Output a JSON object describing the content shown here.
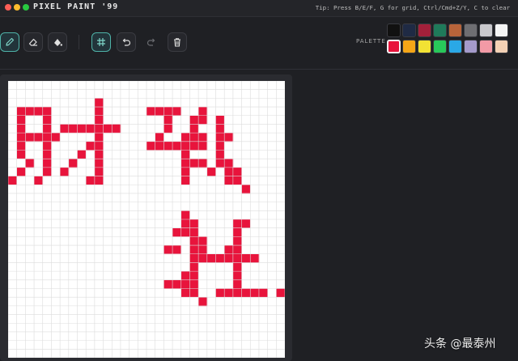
{
  "window": {
    "title": "PIXEL PAINT '99",
    "tip": "Tip: Press B/E/F, G for grid, Ctrl/Cmd+Z/Y, C to clear"
  },
  "toolbar": {
    "tools": [
      {
        "name": "pencil-tool",
        "icon": "pencil-icon",
        "active": true
      },
      {
        "name": "eraser-tool",
        "icon": "eraser-icon",
        "active": false
      },
      {
        "name": "fill-tool",
        "icon": "paint-bucket-icon",
        "active": false
      }
    ],
    "actions": [
      {
        "name": "grid-toggle",
        "icon": "grid-icon",
        "active": true
      },
      {
        "name": "undo",
        "icon": "undo-icon",
        "active": false
      },
      {
        "name": "redo",
        "icon": "redo-icon",
        "active": false
      },
      {
        "name": "clear",
        "icon": "trash-icon",
        "active": false
      }
    ]
  },
  "palette": {
    "label": "PALETTE",
    "colors": [
      "#111111",
      "#1f2a44",
      "#a3203a",
      "#1f7a5a",
      "#b8643a",
      "#6e6e72",
      "#c8c8cc",
      "#f4f4f4",
      "#e8143c",
      "#f5a617",
      "#f2e234",
      "#28c85a",
      "#2aa8e6",
      "#a49acb",
      "#f29aa6",
      "#f3d1b5"
    ],
    "selected": "#e8143c"
  },
  "canvas": {
    "cols": 32,
    "rows": 32,
    "background": "#ffffff",
    "grid_color": "#dcdcdc",
    "ink": "#e8143c",
    "rows_art": [
      "................................",
      "................................",
      "..........#.....................",
      ".####.....#.....####..#.........",
      ".#..#.....#.......#..##.#.......",
      ".#..#.#######.....#..#..#.......",
      ".#####....#......#..###.##......",
      ".#..#....##.....#######.#.......",
      ".#..#...#.#.........#...#.......",
      "..#.#..#..#.........###.##......",
      ".#..#.#...#.........#..#.##.....",
      "#..#.....##.........#....##.....",
      "...........................#....",
      "................................",
      "................................",
      "....................#...........",
      "....................##....##....",
      "...................###....#.....",
      ".....................##...#.....",
      "..................##.##..##.....",
      ".....................########...",
      ".....................#....#.....",
      "....................##....#.....",
      "..................####....#.....",
      "....................##..######.#",
      "......................#.........",
      "................................",
      "................................",
      "................................",
      "................................",
      "................................",
      "................................"
    ]
  },
  "watermark": "头条 @最泰州"
}
